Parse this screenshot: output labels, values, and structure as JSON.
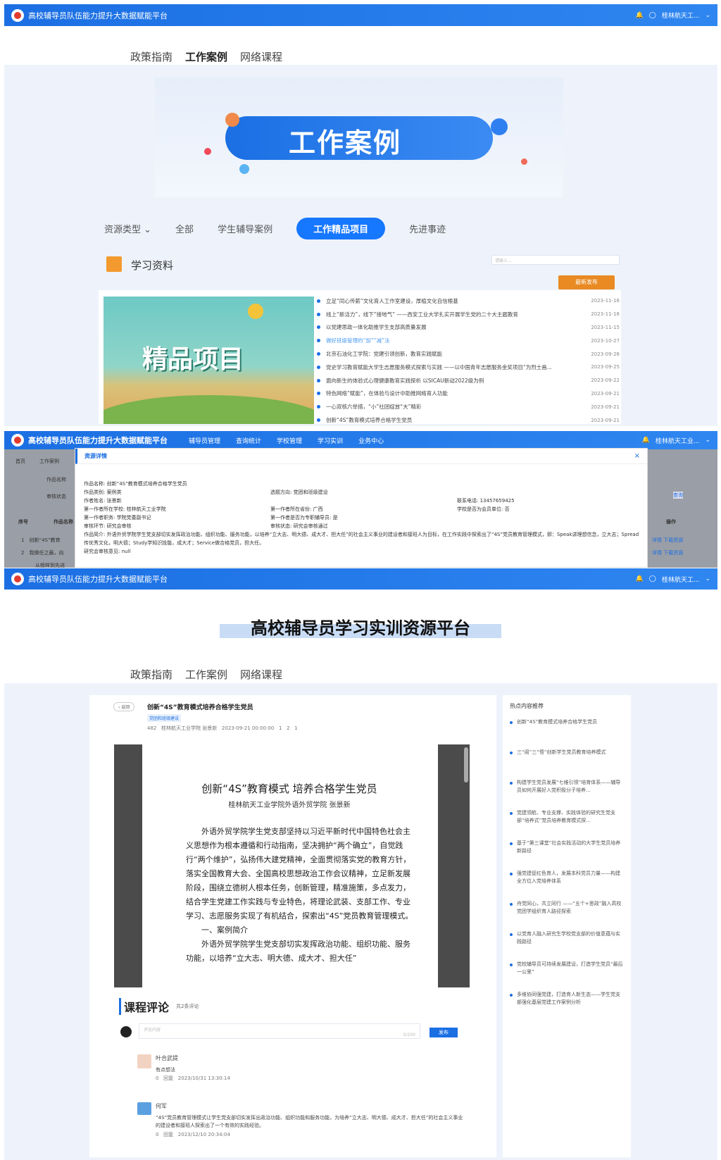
{
  "platform_title": "高校辅导员队伍能力提升大数据赋能平台",
  "user": "桂林航天工...",
  "user2": "桂林航天工业...",
  "tabs": [
    "政策指南",
    "工作案例",
    "网络课程"
  ],
  "banner": "工作案例",
  "filters": {
    "type": "资源类型",
    "all": "全部",
    "f1": "学生辅导案例",
    "active": "工作精品项目",
    "f3": "先进事迹"
  },
  "section": "学习资料",
  "search_placeholder": "请输入...",
  "sort_btn": "最新发布",
  "thumb_title": "精品项目",
  "list": [
    {
      "t": "立足“同心传薪”文化育人工作室建设，厚植文化自信根基",
      "d": "2023-11-16"
    },
    {
      "t": "线上“新活力”，线下“接地气” ——西安工业大学扎实开展学生党的二十大主题教育",
      "d": "2023-11-16"
    },
    {
      "t": "以党建思政一体化助推学生支部高质量发展",
      "d": "2023-11-15"
    },
    {
      "t": "做好班级管理的“加”“减”法",
      "d": "2023-10-27"
    },
    {
      "t": "北京石油化工学院：党建引领创新，教育实践赋能",
      "d": "2023-09-26"
    },
    {
      "t": "党史学习教育赋能大学生志愿服务模式探索与实践 ——以中国青年志愿服务金奖项目“为烈士画...",
      "d": "2023-09-25"
    },
    {
      "t": "面向新生的体验式心理健康教育实践探析 以SICAU新动2022级为例",
      "d": "2023-09-22"
    },
    {
      "t": "特色网络“赋能”，在体验与设计中助推网络育人功能",
      "d": "2023-09-21"
    },
    {
      "t": "一心双核六举措，“小”社团绽放“大”精彩",
      "d": "2023-09-21"
    },
    {
      "t": "创新“4S”教育模式培养合格学生党员",
      "d": "2023-09-21"
    }
  ],
  "nav2": [
    "辅导员管理",
    "查询统计",
    "学校管理",
    "学习实训",
    "业务中心"
  ],
  "crumbs": [
    "首页",
    "工作案例"
  ],
  "modal": {
    "title": "资源详情",
    "name": "作品名称: 创新“4S”教育模式培养合格学生党员",
    "cat": "作品类别: 案例类",
    "dir": "选题方向: 党团和班级建设",
    "author": "作者姓名: 张景新",
    "phone": "联系电话: 13457659425",
    "school": "第一作者所在学校: 桂林航天工业学院",
    "prov": "第一作者所在省份: 广西",
    "member": "学校是否为会员单位: 否",
    "post": "第一作者职务: 学院党委副书记",
    "full": "第一作者是否为专职辅导员: 是",
    "step": "审核环节: 研究会审核",
    "status": "审核状态: 研究会审核通过",
    "intro": "作品简介: 外语外贸学院学生党支部切实发挥政治功能、组织功能、服务功能，以培养“立大志、明大德、成大才、担大任”的社会主义事业的建设者和接班人为目标，在工作实践中探索出了“4S”党员教育管理模式，即：Speak讲理想信念，立大志；Spread传优秀文化，明大德；Study学知识技能，成大才；Service做合格党员，担大任。",
    "opinion": "研究会审核意见: null"
  },
  "table": {
    "cols": [
      "序号",
      "作品名称",
      "操作"
    ],
    "rows": [
      [
        "1",
        "创新“4S”教育"
      ],
      [
        "2",
        "我做任之最，向"
      ],
      [
        "3",
        "从榜样到先进"
      ]
    ],
    "ops": [
      "详情",
      "下载资源"
    ],
    "q": "查询",
    "filter_labels": [
      "作品名称",
      "审核状态"
    ]
  },
  "page3_title": "高校辅导员学习实训资源平台",
  "article": {
    "back": "返回",
    "title": "创新“4S”教育模式培养合格学生党员",
    "tag": "党团和班级建设",
    "meta": "482   桂林航天工业学院 张景新   2023-09-21 00:00:00   1   2   1",
    "doc_title": "创新“4S”教育模式  培养合格学生党员",
    "doc_sub": "桂林航天工业学院外语外贸学院 张景新",
    "p1": "外语外贸学院学生党支部坚持以习近平新时代中国特色社会主义思想作为根本遵循和行动指南，坚决拥护“两个确立”，自觉践行“两个维护”，弘扬伟大建党精神，全面贯彻落实党的教育方针，落实全国教育大会、全国高校思想政治工作会议精神，立足新发展阶段，围绕立德树人根本任务，创新管理，精准施策，多点发力，结合学生党建工作实践与专业特色，将理论武装、支部工作、专业学习、志愿服务实现了有机结合，探索出“4S”党员教育管理模式。",
    "h1": "一、案例简介",
    "p2": "外语外贸学院学生党支部切实发挥政治功能、组织功能、服务功能，以培养“立大志、明大德、成大才、担大任”"
  },
  "comments": {
    "title": "课程评论",
    "count": "共2条评论",
    "placeholder": "评论内容",
    "limit": "0/200",
    "publish": "发布",
    "items": [
      {
        "name": "叶合武提",
        "text": "有点想法",
        "meta": "0   回复   2023/10/31 13:30:14"
      },
      {
        "name": "何军",
        "text": "“4S”党员教育管理模式让学生党支部切实发挥出政治功能、组织功能和服务功能，为培养“立大志、明大德、成大才、担大任”的社会主义事业的建设者和接班人探索出了一个有效的实践经验。",
        "meta": "0   回复   2023/12/10 20:34:04"
      }
    ]
  },
  "hot": {
    "title": "热点内容推荐",
    "items": [
      "创新“4S”教育模式培养合格学生党员",
      "三“阅”三“悟”创新学生党员教育培养模式",
      "构建学生党员发展“七维引领”培育体系——辅导员如何开展好入党积极分子培养...",
      "党建领航、专业支撑、实践体验的研究生党支部“培养式”党员培养教育模式探...",
      "基于“第三课堂”社会实践活动的大学生党员培养新路径",
      "强党建促红色育人，发展本科党员力量——构建全方位入党培养体系",
      "舟党同心，共立同行 ——“五个+思政”融入高校党团学组织育人路径探索",
      "以党育人融入研究生学校党支部的价值意蕴与实践路径",
      "党校辅导员可持续发展建设，打造学生党员“最后一公里”",
      "多维协同强党建，打造育人新生态——学生党支部强化基层党建工作案例分析"
    ]
  }
}
